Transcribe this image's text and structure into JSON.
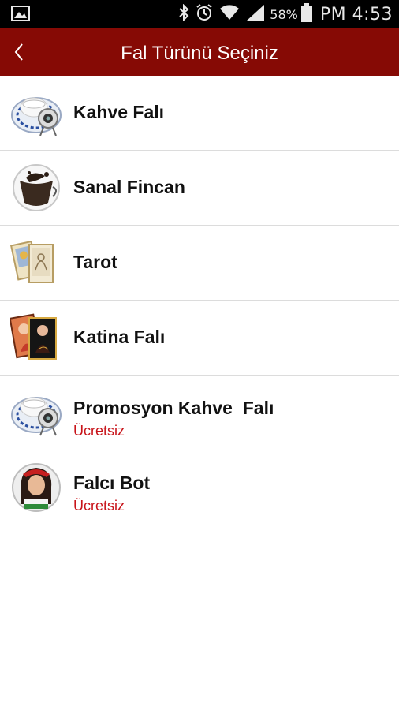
{
  "status_bar": {
    "battery_percent": "58%",
    "ampm": "PM",
    "time": "4:53",
    "icons": [
      "image-icon",
      "bluetooth-icon",
      "alarm-icon",
      "wifi-icon",
      "signal-icon",
      "battery-icon"
    ]
  },
  "header": {
    "title": "Fal Türünü Seçiniz",
    "back_icon": "back-chevron-icon",
    "bar_color": "#860a05"
  },
  "items": [
    {
      "label": "Kahve Falı",
      "sub": "",
      "icon": "coffee-cup-icon"
    },
    {
      "label": "Sanal Fincan",
      "sub": "",
      "icon": "virtual-cup-icon"
    },
    {
      "label": "Tarot",
      "sub": "",
      "icon": "tarot-cards-icon"
    },
    {
      "label": "Katina Falı",
      "sub": "",
      "icon": "katina-cards-icon"
    },
    {
      "label": "Promosyon Kahve  Falı",
      "sub": "Ücretsiz",
      "icon": "coffee-cup-icon"
    },
    {
      "label": "Falcı Bot",
      "sub": "Ücretsiz",
      "icon": "fortune-teller-avatar"
    }
  ],
  "colors": {
    "accent": "#860a05",
    "free_badge": "#c8141a"
  }
}
